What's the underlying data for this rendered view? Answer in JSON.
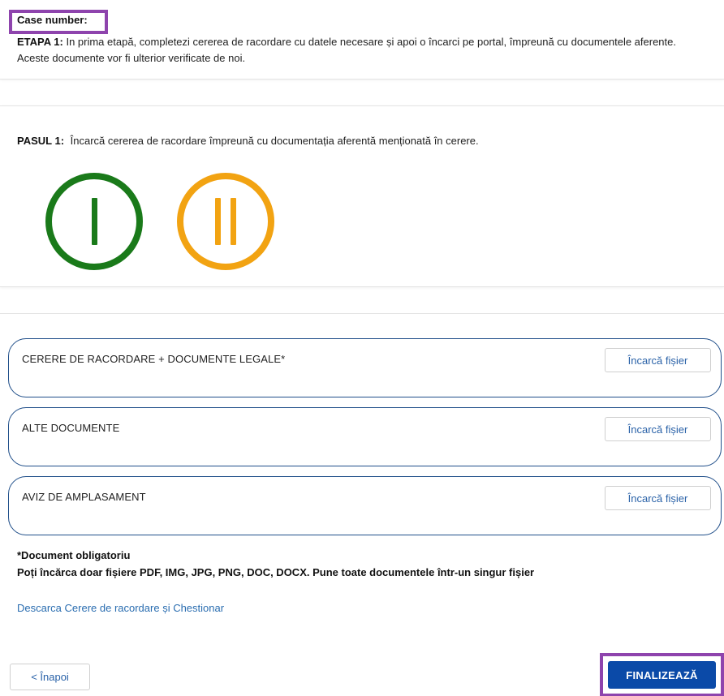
{
  "header": {
    "case_label": "Case number:",
    "etapa_label": "ETAPA 1:",
    "etapa_text": "In prima etapă, completezi cererea de racordare cu datele necesare și apoi o încarci pe portal, împreună cu documentele aferente. Aceste documente vor fi ulterior verificate de noi."
  },
  "step": {
    "pasul_label": "PASUL 1:",
    "pasul_text": "Încarcă cererea de racordare împreună cu documentația aferentă menționată în cerere.",
    "indicators": [
      {
        "roman": "I",
        "status": "completed",
        "color": "#1a7a1a"
      },
      {
        "roman": "II",
        "status": "current",
        "color": "#f2a312"
      }
    ]
  },
  "uploads": {
    "rows": [
      {
        "label": "CERERE DE RACORDARE + DOCUMENTE LEGALE*",
        "button": "Încarcă fișier"
      },
      {
        "label": "ALTE DOCUMENTE",
        "button": "Încarcă fișier"
      },
      {
        "label": "AVIZ DE AMPLASAMENT",
        "button": "Încarcă fișier"
      }
    ],
    "required_note": "*Document obligatoriu",
    "formats_note": "Poți încărca doar fișiere PDF, IMG, JPG, PNG, DOC, DOCX. Pune toate documentele într-un singur fișier",
    "download_link": "Descarca Cerere de racordare și Chestionar"
  },
  "footer": {
    "back_label": "< Înapoi",
    "finalize_label": "FINALIZEAZĂ"
  },
  "colors": {
    "highlight": "#8e44ad",
    "primary": "#0b4aa8",
    "row_border": "#1f4e89",
    "link": "#2a6db0"
  }
}
